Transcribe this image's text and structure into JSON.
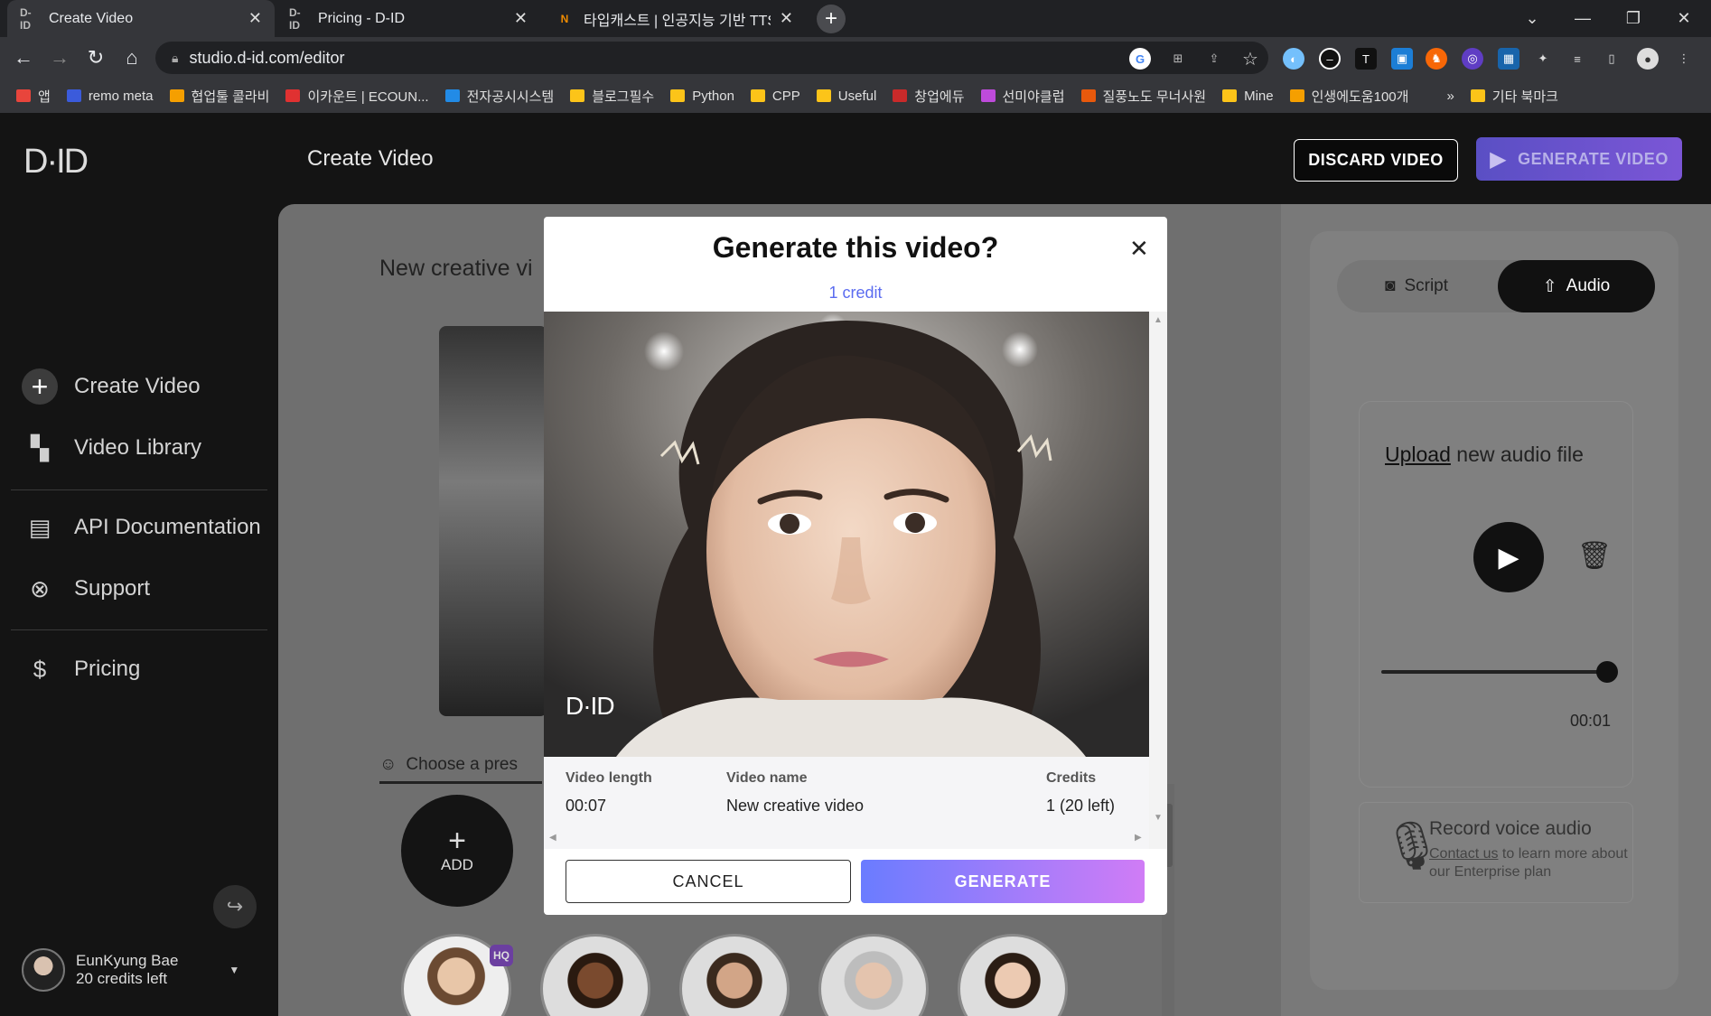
{
  "browser": {
    "tabs": [
      {
        "favicon": "D-ID",
        "title": "Create Video",
        "active": true
      },
      {
        "favicon": "D-ID",
        "title": "Pricing - D-ID",
        "active": false
      },
      {
        "favicon": "N",
        "title": "타입캐스트 | 인공지능 기반 TTS",
        "active": false
      }
    ],
    "url": "studio.d-id.com/editor",
    "bookmarks": [
      {
        "label": "앱",
        "color": "#e8453c"
      },
      {
        "label": "remo meta",
        "color": "#3b5bdb"
      },
      {
        "label": "협업툴 콜라비",
        "color": "#f59f00"
      },
      {
        "label": "이카운트 | ECOUN...",
        "color": "#e03131"
      },
      {
        "label": "전자공시시스템",
        "color": "#228be6"
      },
      {
        "label": "블로그필수",
        "color": "#fcc419"
      },
      {
        "label": "Python",
        "color": "#fcc419"
      },
      {
        "label": "CPP",
        "color": "#fcc419"
      },
      {
        "label": "Useful",
        "color": "#fcc419"
      },
      {
        "label": "창업에듀",
        "color": "#c92a2a"
      },
      {
        "label": "선미야클럽",
        "color": "#be4bdb"
      },
      {
        "label": "질풍노도 무너사원",
        "color": "#e8590c"
      },
      {
        "label": "Mine",
        "color": "#fcc419"
      },
      {
        "label": "인생에도움100개",
        "color": "#f59f00"
      },
      {
        "label": "»",
        "color": "transparent"
      },
      {
        "label": "기타 북마크",
        "color": "#fcc419"
      }
    ]
  },
  "app": {
    "logo": "D·ID",
    "header_title": "Create Video",
    "discard_label": "DISCARD VIDEO",
    "generate_label": "GENERATE VIDEO",
    "nav": [
      {
        "label": "Create Video",
        "icon": "plus-icon"
      },
      {
        "label": "Video Library",
        "icon": "grid-icon"
      },
      {
        "label": "API Documentation",
        "icon": "document-icon"
      },
      {
        "label": "Support",
        "icon": "lifebuoy-icon"
      },
      {
        "label": "Pricing",
        "icon": "dollar-icon"
      }
    ],
    "user": {
      "name": "EunKyung Bae",
      "credits": "20 credits left"
    },
    "editor": {
      "video_title": "New creative vi",
      "choose_presenter": "Choose a pres",
      "add_label": "ADD",
      "hq_badge": "HQ"
    },
    "right_panel": {
      "tab_script": "Script",
      "tab_audio": "Audio",
      "upload_link": "Upload",
      "upload_rest": " new audio file",
      "audio_time": "00:01",
      "audio_progress": 1.0,
      "record_title": "Record voice audio",
      "record_link": "Contact us",
      "record_rest": " to learn more about our Enterprise plan"
    }
  },
  "modal": {
    "title": "Generate this video?",
    "credit_text": "1 credit",
    "watermark": "D·ID",
    "info": {
      "length_label": "Video length",
      "length_value": "00:07",
      "name_label": "Video name",
      "name_value": "New creative video",
      "credits_label": "Credits",
      "credits_value": "1 (20 left)"
    },
    "cancel_label": "CANCEL",
    "generate_label": "GENERATE"
  }
}
